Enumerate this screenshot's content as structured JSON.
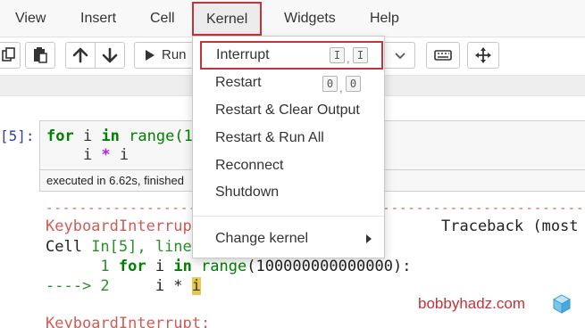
{
  "menubar": {
    "items": [
      "View",
      "Insert",
      "Cell",
      "Kernel",
      "Widgets",
      "Help"
    ]
  },
  "toolbar": {
    "run_label": "Run"
  },
  "cell": {
    "prompt": "[5]:",
    "code_line1": {
      "kw1": "for",
      "var1": " i ",
      "kw2": "in",
      "fn": " range(1"
    },
    "code_line2": {
      "indent": "    i ",
      "op": "*",
      "tail": " i"
    },
    "exec_info": "executed in 6.62s, finished"
  },
  "output": {
    "dashes": "-----------------------------------------------------------------------------",
    "err_name": "KeyboardInterrupt",
    "traceback": "Traceback (most",
    "cell_ref_pre": "Cell ",
    "cell_ref_in": "In[5], line",
    "line1_num": "      1 ",
    "line1_kw": "for",
    "line1_mid": " i ",
    "line1_in": "in",
    "line1_fn": " range",
    "line1_args": "(100000000000000):",
    "line2_arrow": "----> 2",
    "line2_code": "     i * ",
    "line2_hl": "i",
    "final_err": "KeyboardInterrupt:"
  },
  "kernel_menu": {
    "interrupt": "Interrupt",
    "interrupt_keys": [
      "I",
      "I"
    ],
    "restart": "Restart",
    "restart_keys": [
      "0",
      "0"
    ],
    "restart_clear": "Restart & Clear Output",
    "restart_run": "Restart & Run All",
    "reconnect": "Reconnect",
    "shutdown": "Shutdown",
    "change_kernel": "Change kernel"
  },
  "watermark": "bobbyhadz.com",
  "colors": {
    "accent_red": "#c4323a",
    "code_green": "#008000",
    "error_red": "#d15b55"
  }
}
